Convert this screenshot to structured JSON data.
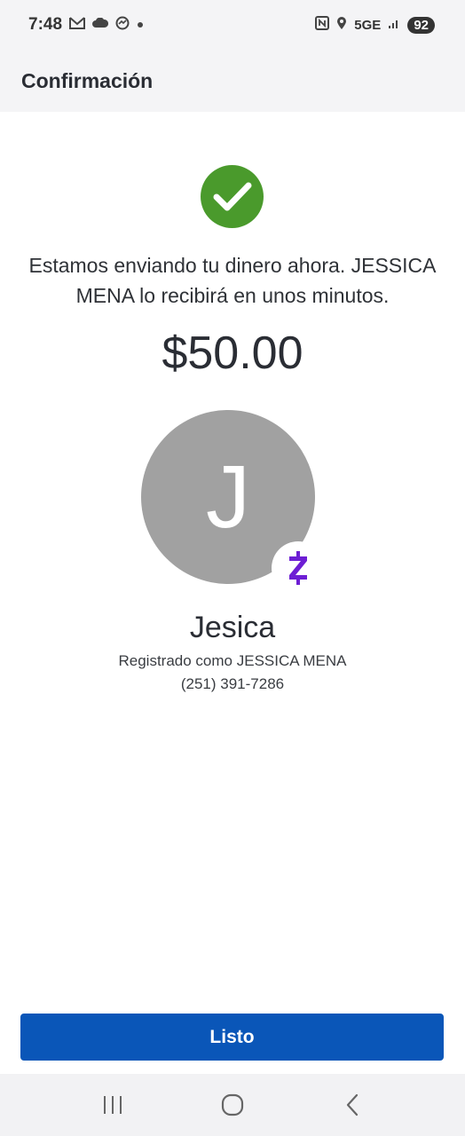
{
  "status_bar": {
    "time": "7:48",
    "network": "5GE",
    "battery": "92"
  },
  "header": {
    "title": "Confirmación"
  },
  "confirmation": {
    "message": "Estamos enviando tu dinero ahora. JESSICA MENA lo recibirá en unos minutos.",
    "amount": "$50.00"
  },
  "recipient": {
    "initial": "J",
    "name": "Jesica",
    "registered_as": "Registrado como JESSICA MENA",
    "phone": "(251) 391-7286",
    "badge_icon": "zelle-icon"
  },
  "actions": {
    "done_label": "Listo"
  },
  "colors": {
    "success": "#4a9a2c",
    "primary": "#0a56b8",
    "zelle": "#6d1ed4",
    "avatar_bg": "#a1a1a1"
  }
}
